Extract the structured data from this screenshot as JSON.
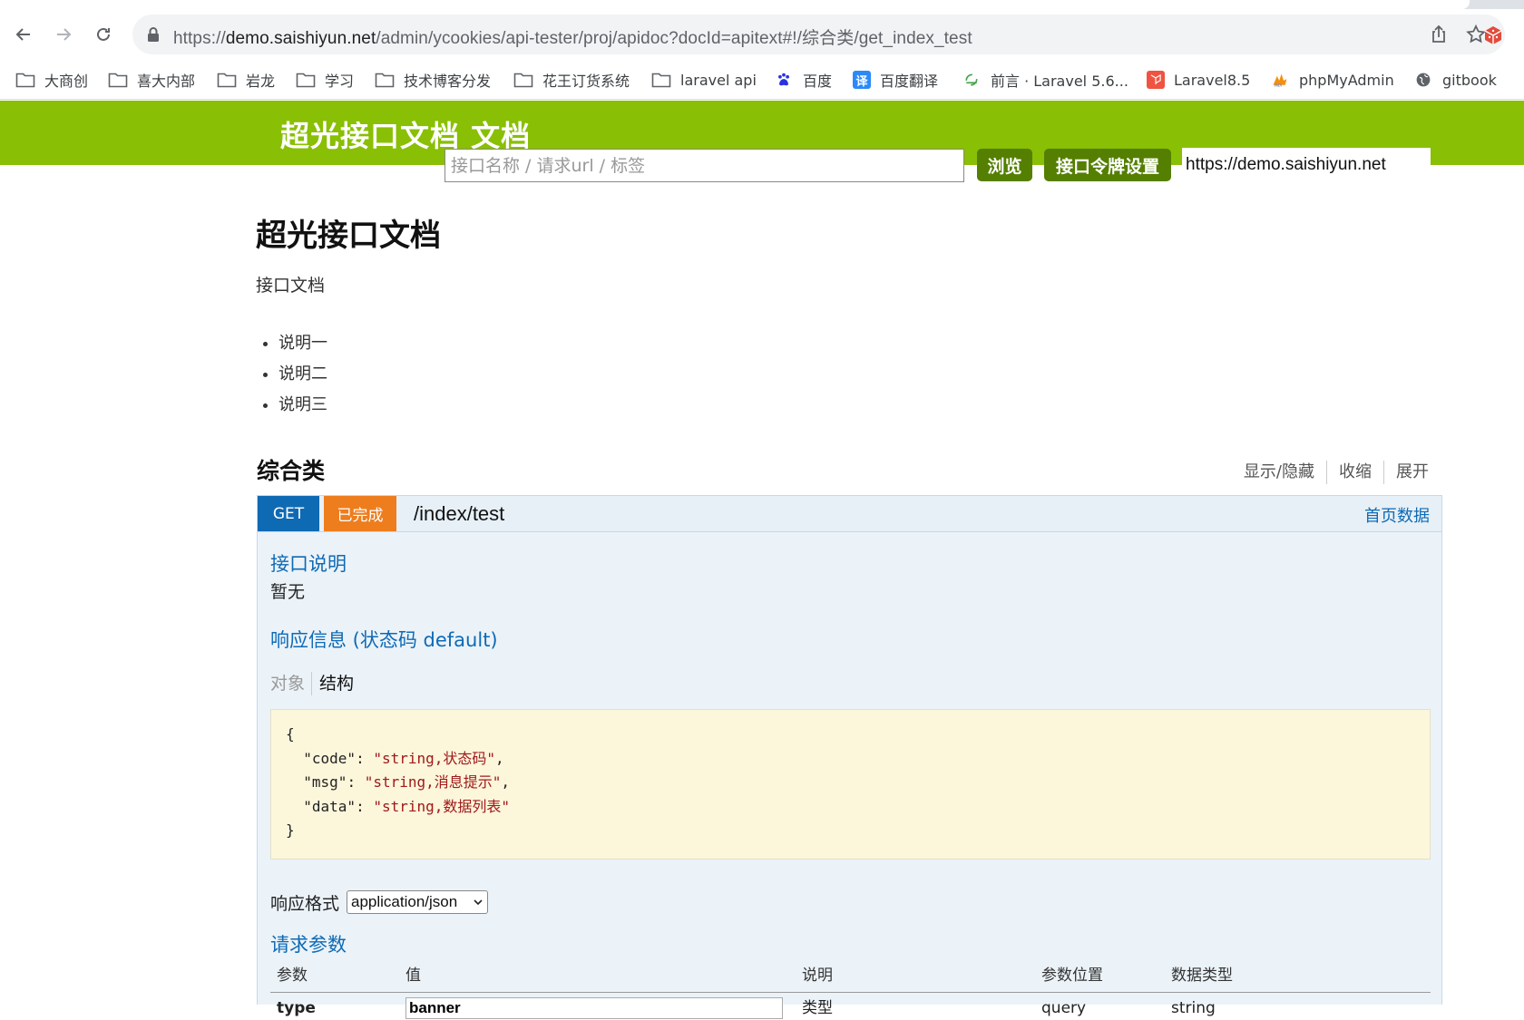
{
  "browser": {
    "url_prefix": "https://",
    "url_host": "demo.saishiyun.net",
    "url_path": "/admin/ycookies/api-tester/proj/apidoc?docId=apitext#!/综合类/get_index_test"
  },
  "bookmarks": [
    {
      "label": "大商创",
      "icon": "folder-icon"
    },
    {
      "label": "喜大内部",
      "icon": "folder-icon"
    },
    {
      "label": "岩龙",
      "icon": "folder-icon"
    },
    {
      "label": "学习",
      "icon": "folder-icon"
    },
    {
      "label": "技术博客分发",
      "icon": "folder-icon"
    },
    {
      "label": "花王订货系统",
      "icon": "folder-icon"
    },
    {
      "label": "laravel api",
      "icon": "folder-icon"
    },
    {
      "label": "百度",
      "icon": "baidu-icon"
    },
    {
      "label": "百度翻译",
      "icon": "translate-icon"
    },
    {
      "label": "前言 · Laravel 5.6...",
      "icon": "laravel-docs-icon"
    },
    {
      "label": "Laravel8.5",
      "icon": "laravel-icon"
    },
    {
      "label": "phpMyAdmin",
      "icon": "phpmyadmin-icon"
    },
    {
      "label": "gitbook",
      "icon": "globe-icon"
    }
  ],
  "header": {
    "brand": "超光接口文档 文档",
    "search_placeholder": "接口名称 / 请求url / 标签",
    "explore_button": "浏览",
    "token_button": "接口令牌设置",
    "base_url": "https://demo.saishiyun.net"
  },
  "info": {
    "title": "超光接口文档",
    "description": "接口文档",
    "notes": [
      "说明一",
      "说明二",
      "说明三"
    ]
  },
  "resource": {
    "name": "综合类",
    "actions": [
      "显示/隐藏",
      "收缩",
      "展开"
    ]
  },
  "operation": {
    "method": "GET",
    "status": "已完成",
    "path": "/index/test",
    "summary": "首页数据",
    "desc_heading": "接口说明",
    "desc_text": "暂无",
    "response_heading": "响应信息 (状态码 default)",
    "response_tabs": [
      "对象",
      "结构"
    ],
    "response_code": {
      "open": "{",
      "lines": [
        {
          "key": "\"code\"",
          "value": "\"string,状态码\"",
          "tail": ","
        },
        {
          "key": "\"msg\"",
          "value": "\"string,消息提示\"",
          "tail": ","
        },
        {
          "key": "\"data\"",
          "value": "\"string,数据列表\"",
          "tail": ""
        }
      ],
      "close": "}"
    },
    "format_label": "响应格式",
    "format_value": "application/json",
    "params_heading": "请求参数",
    "params_columns": [
      "参数",
      "值",
      "说明",
      "参数位置",
      "数据类型"
    ],
    "params_rows": [
      {
        "name": "type",
        "value": "banner",
        "desc": "类型",
        "location": "query",
        "type": "string"
      }
    ]
  },
  "colors": {
    "header_green": "#89bf04",
    "button_green": "#547f00",
    "get_blue": "#0f6ab4",
    "status_orange": "#ee7d1e"
  }
}
